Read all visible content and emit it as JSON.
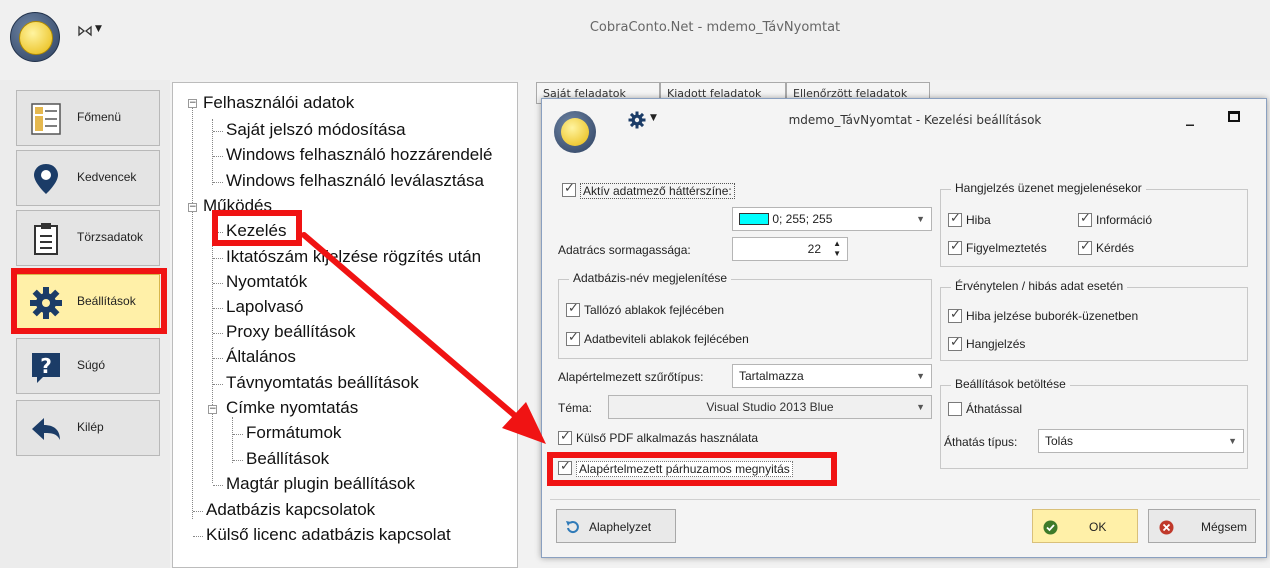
{
  "app": {
    "title": "CobraConto.Net - mdemo_TávNyomtat"
  },
  "nav": [
    {
      "label": "Főmenü",
      "icon": "main-menu-icon"
    },
    {
      "label": "Kedvencek",
      "icon": "map-pin-icon"
    },
    {
      "label": "Törzsadatok",
      "icon": "clipboard-icon"
    },
    {
      "label": "Beállítások",
      "icon": "gear-icon",
      "active": true
    },
    {
      "label": "Súgó",
      "icon": "help-icon"
    },
    {
      "label": "Kilép",
      "icon": "back-arrow-icon"
    }
  ],
  "tree": [
    {
      "label": "Felhasználói adatok"
    },
    {
      "label": "Saját jelszó módosítása"
    },
    {
      "label": "Windows felhasználó hozzárendelé"
    },
    {
      "label": "Windows felhasználó leválasztása"
    },
    {
      "label": "Működés"
    },
    {
      "label": "Kezelés"
    },
    {
      "label": "Iktatószám kijelzése rögzítés után"
    },
    {
      "label": "Nyomtatók"
    },
    {
      "label": "Lapolvasó"
    },
    {
      "label": "Proxy beállítások"
    },
    {
      "label": "Általános"
    },
    {
      "label": "Távnyomtatás beállítások"
    },
    {
      "label": "Címke nyomtatás"
    },
    {
      "label": "Formátumok"
    },
    {
      "label": "Beállítások"
    },
    {
      "label": "Magtár plugin beállítások"
    },
    {
      "label": "Adatbázis kapcsolatok"
    },
    {
      "label": "Külső licenc adatbázis kapcsolat"
    }
  ],
  "bg_tabs": [
    "Saját feladatok",
    "Kiadott feladatok",
    "Ellenőrzött feladatok"
  ],
  "dialog": {
    "title": "mdemo_TávNyomtat - Kezelési beállítások",
    "active_bg_label": "Aktív adatmező háttérszíne:",
    "active_bg_checked": true,
    "color_value": "0; 255; 255",
    "color_swatch": "#00ffff",
    "row_height_label": "Adatrács sormagassága:",
    "row_height_value": "22",
    "db_name_group": "Adatbázis-név megjelenítése",
    "browse_header_label": "Tallózó ablakok fejlécében",
    "browse_header_checked": true,
    "entry_header_label": "Adatbeviteli ablakok fejlécében",
    "entry_header_checked": true,
    "filter_type_label": "Alapértelmezett szűrőtípus:",
    "filter_type_value": "Tartalmazza",
    "theme_label": "Téma:",
    "theme_value": "Visual Studio 2013 Blue",
    "external_pdf_label": "Külső PDF alkalmazás használata",
    "external_pdf_checked": true,
    "parallel_open_label": "Alapértelmezett párhuzamos megnyitás",
    "parallel_open_checked": true,
    "sound_group": "Hangjelzés üzenet megjelenésekor",
    "sound_error": "Hiba",
    "sound_info": "Információ",
    "sound_warning": "Figyelmeztetés",
    "sound_question": "Kérdés",
    "invalid_group": "Érvénytelen / hibás adat esetén",
    "invalid_bubble": "Hiba jelzése buborék-üzenetben",
    "invalid_sound": "Hangjelzés",
    "load_group": "Beállítások betöltése",
    "transparency_label": "Áthatással",
    "transparency_checked": false,
    "transparency_type_label": "Áthatás típus:",
    "transparency_type_value": "Tolás",
    "reset_label": "Alaphelyzet",
    "ok_label": "OK",
    "cancel_label": "Mégsem"
  }
}
